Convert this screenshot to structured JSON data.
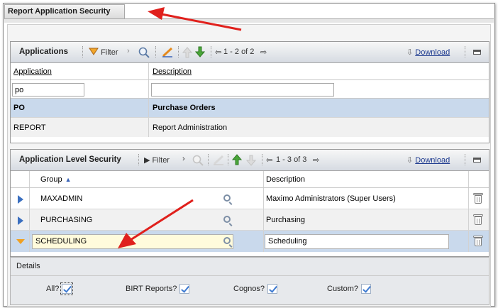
{
  "window": {
    "title": "Report Application Security"
  },
  "applications": {
    "title": "Applications",
    "filter_label": "Filter",
    "pagination": "1 - 2 of 2",
    "download_label": "Download",
    "columns": [
      "Application",
      "Description"
    ],
    "filter_values": {
      "application": "po",
      "description": ""
    },
    "rows": [
      {
        "application": "PO",
        "description": "Purchase Orders",
        "selected": true
      },
      {
        "application": "REPORT",
        "description": "Report Administration",
        "selected": false
      }
    ]
  },
  "security": {
    "title": "Application Level Security",
    "filter_label": "Filter",
    "pagination": "1 - 3 of 3",
    "download_label": "Download",
    "columns": [
      "Group",
      "Description"
    ],
    "rows": [
      {
        "group": "MAXADMIN",
        "description": "Maximo Administrators (Super Users)"
      },
      {
        "group": "PURCHASING",
        "description": "Purchasing"
      },
      {
        "group": "SCHEDULING",
        "description": "Scheduling"
      }
    ]
  },
  "details": {
    "title": "Details",
    "checkboxes": [
      {
        "label": "All?",
        "checked": true
      },
      {
        "label": "BIRT Reports?",
        "checked": true
      },
      {
        "label": "Cognos?",
        "checked": true
      },
      {
        "label": "Custom?",
        "checked": true
      }
    ]
  },
  "colors": {
    "accent_blue": "#1d3a8f",
    "selected_row": "#c9d9ec",
    "annotation_red": "#e0201c",
    "edit_field": "#fffbdc"
  },
  "icons": [
    "filter-icon",
    "search-icon",
    "clear-icon",
    "arrow-up-icon",
    "arrow-down-icon",
    "download-icon",
    "minimize-icon",
    "expand-row-icon",
    "collapse-row-icon",
    "lookup-icon",
    "delete-icon",
    "sort-asc-icon"
  ]
}
